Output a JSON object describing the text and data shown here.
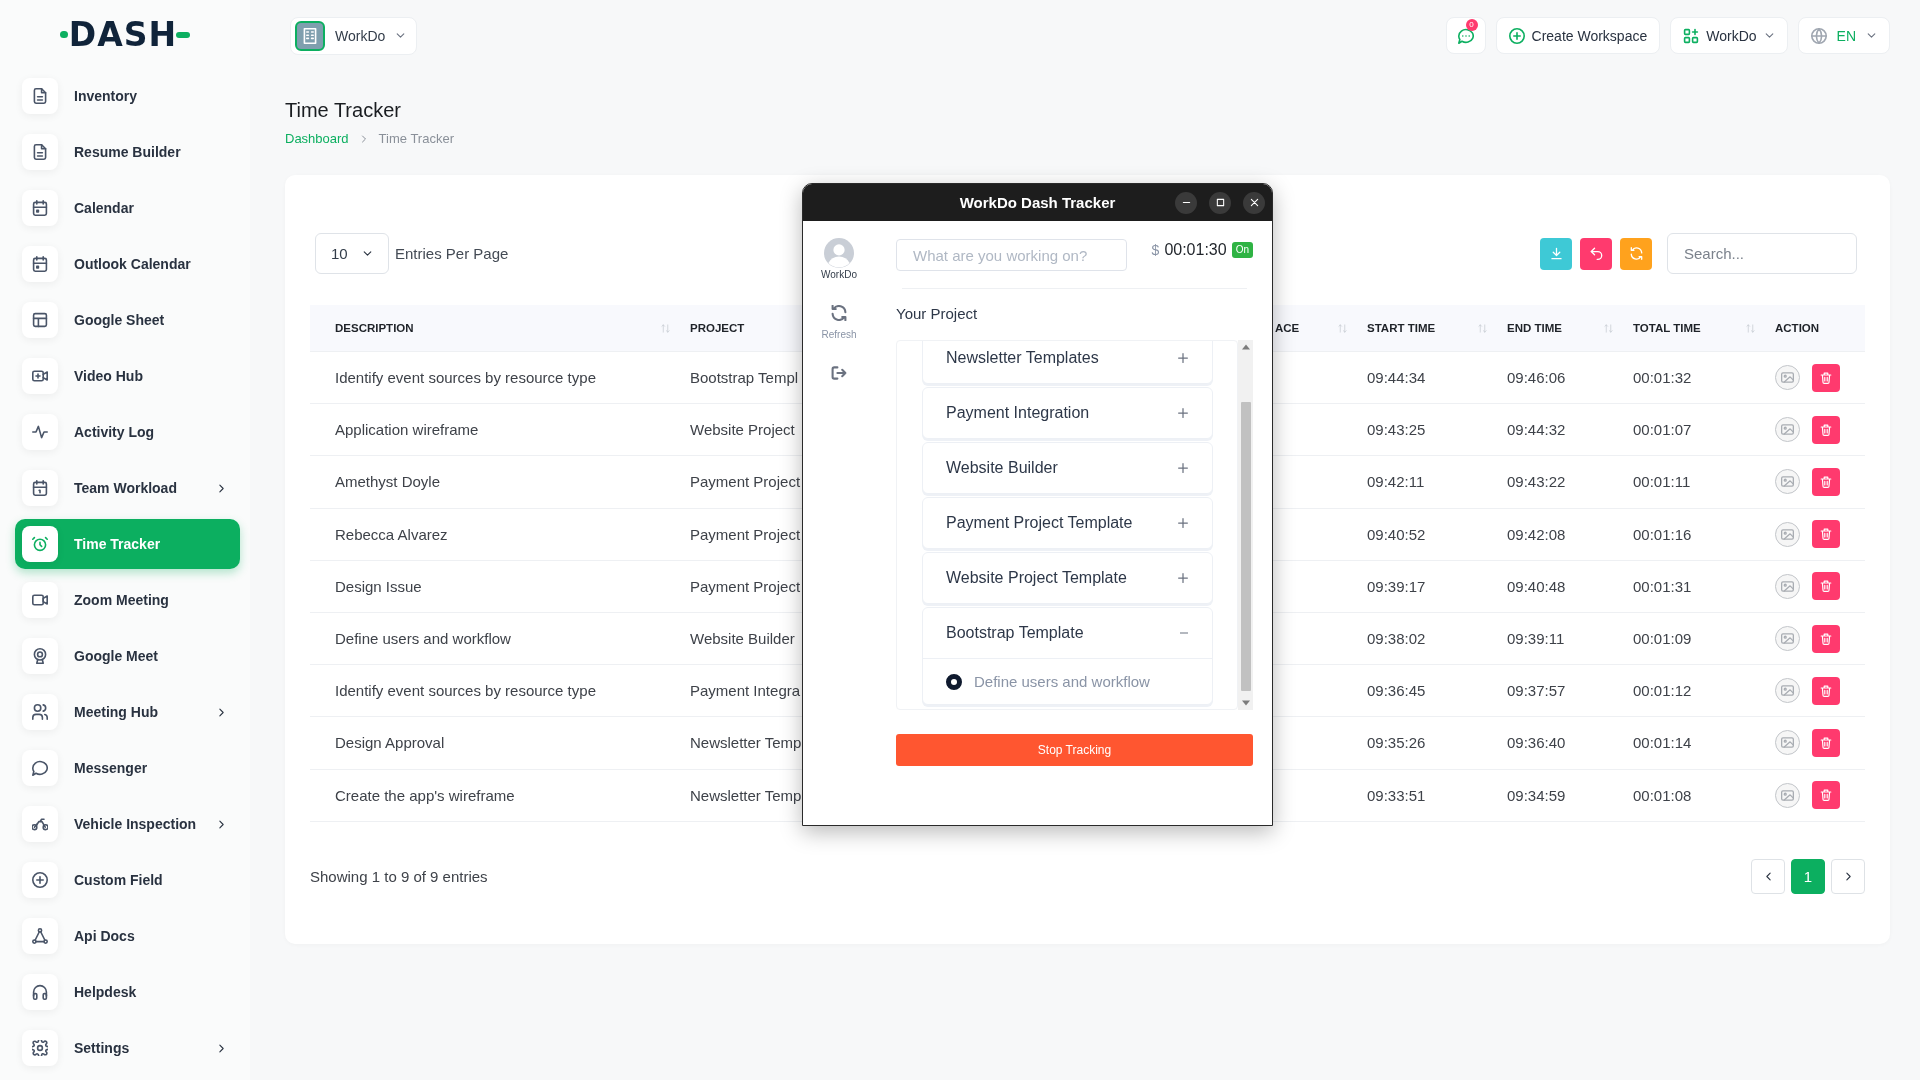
{
  "sidebar": {
    "logo": "DASH",
    "items": [
      {
        "label": "Inventory",
        "selected": false,
        "submenu": false
      },
      {
        "label": "Resume Builder",
        "selected": false,
        "submenu": false
      },
      {
        "label": "Calendar",
        "selected": false,
        "submenu": false
      },
      {
        "label": "Outlook Calendar",
        "selected": false,
        "submenu": false
      },
      {
        "label": "Google Sheet",
        "selected": false,
        "submenu": false
      },
      {
        "label": "Video Hub",
        "selected": false,
        "submenu": false
      },
      {
        "label": "Activity Log",
        "selected": false,
        "submenu": false
      },
      {
        "label": "Team Workload",
        "selected": false,
        "submenu": true
      },
      {
        "label": "Time Tracker",
        "selected": true,
        "submenu": false
      },
      {
        "label": "Zoom Meeting",
        "selected": false,
        "submenu": false
      },
      {
        "label": "Google Meet",
        "selected": false,
        "submenu": false
      },
      {
        "label": "Meeting Hub",
        "selected": false,
        "submenu": true
      },
      {
        "label": "Messenger",
        "selected": false,
        "submenu": false
      },
      {
        "label": "Vehicle Inspection",
        "selected": false,
        "submenu": true
      },
      {
        "label": "Custom Field",
        "selected": false,
        "submenu": false
      },
      {
        "label": "Api Docs",
        "selected": false,
        "submenu": false
      },
      {
        "label": "Helpdesk",
        "selected": false,
        "submenu": false
      },
      {
        "label": "Settings",
        "selected": false,
        "submenu": true
      }
    ]
  },
  "header": {
    "workspace": "WorkDo",
    "notification_count": "0",
    "create_workspace": "Create Workspace",
    "user_menu": "WorkDo",
    "language": "EN"
  },
  "page": {
    "title": "Time Tracker",
    "breadcrumb": [
      "Dashboard",
      "Time Tracker"
    ]
  },
  "table_controls": {
    "entries_per_page": "10",
    "entries_label": "Entries Per Page",
    "search": {
      "placeholder": "Search..."
    }
  },
  "table": {
    "columns": [
      {
        "label": "DESCRIPTION",
        "sortable": true
      },
      {
        "label": "PROJECT",
        "sortable": false
      },
      {
        "label": "ACE",
        "sortable": true
      },
      {
        "label": "START TIME",
        "sortable": true
      },
      {
        "label": "END TIME",
        "sortable": true
      },
      {
        "label": "TOTAL TIME",
        "sortable": true
      },
      {
        "label": "ACTION",
        "sortable": false
      }
    ],
    "rows": [
      {
        "description": "Identify event sources by resource type",
        "project": "Bootstrap Templ",
        "start_time": "09:44:34",
        "end_time": "09:46:06",
        "total_time": "00:01:32"
      },
      {
        "description": "Application wireframe",
        "project": "Website Project",
        "start_time": "09:43:25",
        "end_time": "09:44:32",
        "total_time": "00:01:07"
      },
      {
        "description": "Amethyst Doyle",
        "project": "Payment Project",
        "start_time": "09:42:11",
        "end_time": "09:43:22",
        "total_time": "00:01:11"
      },
      {
        "description": "Rebecca Alvarez",
        "project": "Payment Project",
        "start_time": "09:40:52",
        "end_time": "09:42:08",
        "total_time": "00:01:16"
      },
      {
        "description": "Design Issue",
        "project": "Payment Project",
        "start_time": "09:39:17",
        "end_time": "09:40:48",
        "total_time": "00:01:31"
      },
      {
        "description": "Define users and workflow",
        "project": "Website Builder",
        "start_time": "09:38:02",
        "end_time": "09:39:11",
        "total_time": "00:01:09"
      },
      {
        "description": "Identify event sources by resource type",
        "project": "Payment Integra",
        "start_time": "09:36:45",
        "end_time": "09:37:57",
        "total_time": "00:01:12"
      },
      {
        "description": "Design Approval",
        "project": "Newsletter Temp",
        "start_time": "09:35:26",
        "end_time": "09:36:40",
        "total_time": "00:01:14"
      },
      {
        "description": "Create the app's wireframe",
        "project": "Newsletter Temp",
        "start_time": "09:33:51",
        "end_time": "09:34:59",
        "total_time": "00:01:08"
      }
    ]
  },
  "footer": {
    "summary": "Showing 1 to 9 of 9 entries",
    "pages": [
      {
        "label": "1",
        "selected": true
      }
    ]
  },
  "tracker": {
    "title": "WorkDo Dash Tracker",
    "user": "WorkDo",
    "refresh_label": "Refresh",
    "task_field": {
      "placeholder": "What are you working on?"
    },
    "currency": "$",
    "timer": "00:01:30",
    "status": "On",
    "section_title": "Your Project",
    "projects": [
      {
        "name": "Newsletter Templates",
        "expanded": false
      },
      {
        "name": "Payment Integration",
        "expanded": false
      },
      {
        "name": "Website Builder",
        "expanded": false
      },
      {
        "name": "Payment Project Template",
        "expanded": false
      },
      {
        "name": "Website Project Template",
        "expanded": false
      },
      {
        "name": "Bootstrap Template",
        "expanded": true,
        "tasks": [
          {
            "label": "Define users and workflow",
            "selected": true
          }
        ]
      }
    ],
    "stop_button": "Stop Tracking"
  }
}
